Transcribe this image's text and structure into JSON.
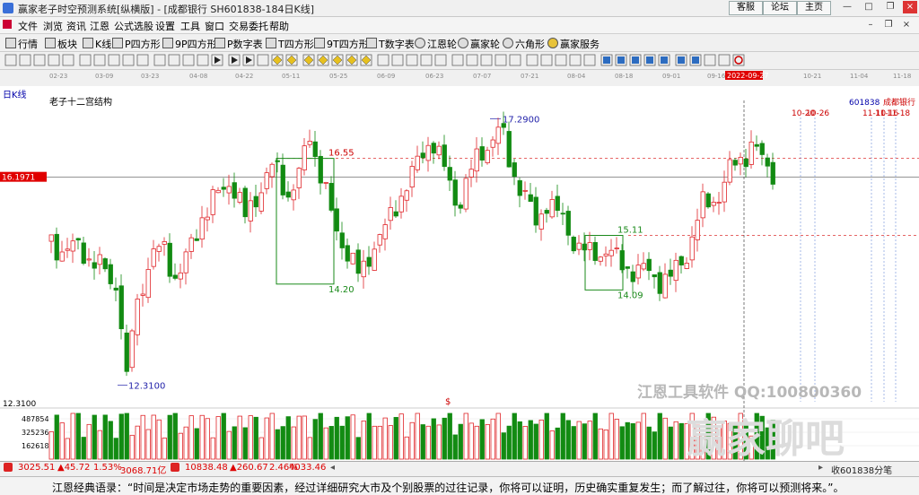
{
  "window": {
    "title": "赢家老子时空预测系统[纵横版] - [成都银行  SH601838-184日K线]",
    "buttons": [
      "客服",
      "论坛",
      "主页"
    ]
  },
  "menu": [
    "文件",
    "浏览",
    "资讯",
    "江恩",
    "公式选股",
    "设置",
    "工具",
    "窗口",
    "交易委托",
    "帮助"
  ],
  "toolbar1": [
    "行情",
    "板块",
    "K线",
    "P四方形",
    "9P四方形",
    "P数字表",
    "T四方形",
    "9T四方形",
    "T数字表",
    "江恩轮",
    "赢家轮",
    "六角形",
    "赢家服务"
  ],
  "chart": {
    "period_label": "日K线",
    "structure_label": "老子十二宫结构",
    "stock_code": "601838",
    "stock_name": "成都银行",
    "date_axis": [
      "02-23",
      "03-09",
      "03-23",
      "04-08",
      "04-22",
      "05-11",
      "05-25",
      "06-09",
      "06-23",
      "07-07",
      "07-21",
      "08-04",
      "08-18",
      "09-01",
      "09-16",
      "2022-09-27",
      "10-21",
      "11-04",
      "11-18"
    ],
    "current_price": "16.1971",
    "y_min_label": "12.3100",
    "annotations": {
      "high": "17.2900",
      "low": "12.3100",
      "box1_top": "16.55",
      "box1_bottom": "14.20",
      "box2_top": "15.11",
      "box2_bottom": "14.09",
      "dollar": "$"
    },
    "future_dates": [
      "10-20",
      "10-26",
      "11-10",
      "11-16",
      "11-18"
    ],
    "volume_axis": [
      "487854",
      "325236",
      "162618"
    ],
    "colors": {
      "up": "#e0262a",
      "down": "#128b12",
      "current_tag": "#e00000"
    }
  },
  "watermarks": {
    "software": "江恩工具软件  QQ:100800360",
    "forum": "赢家聊吧"
  },
  "status": {
    "sh_index": "3025.51",
    "sh_change": "▲45.72",
    "sh_pct": "1.53%",
    "sh_amount": "3068.71亿",
    "sz_index": "10838.48",
    "sz_change": "▲260.67",
    "sz_pct": "2.46%",
    "sz_amount": "4033.46",
    "right_text": "收601838分笔"
  },
  "quote": "江恩经典语录：“时间是决定市场走势的重要因素，经过详细研究大市及个别股票的过往记录，你将可以证明，历史确实重复发生；而了解过往，你将可以预测将来。”。"
}
